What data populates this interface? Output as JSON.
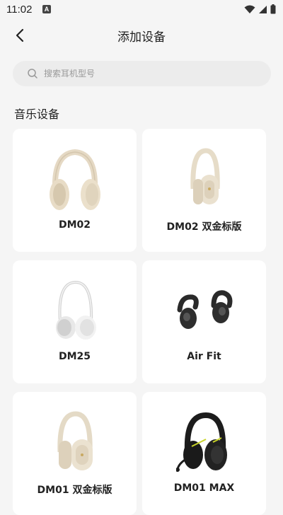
{
  "status": {
    "time": "11:02",
    "notification_badge": "A"
  },
  "header": {
    "title": "添加设备"
  },
  "search": {
    "placeholder": "搜索耳机型号"
  },
  "section": {
    "title": "音乐设备"
  },
  "devices": [
    {
      "label": "DM02",
      "icon": "headphones-cream-icon"
    },
    {
      "label": "DM02 双金标版",
      "icon": "headphones-cream-gold-icon"
    },
    {
      "label": "DM25",
      "icon": "headphones-white-onear-icon"
    },
    {
      "label": "Air Fit",
      "icon": "open-earbuds-icon"
    },
    {
      "label": "DM01 双金标版",
      "icon": "headphones-cream-gold-icon"
    },
    {
      "label": "DM01 MAX",
      "icon": "gaming-headset-black-icon"
    }
  ],
  "colors": {
    "background": "#f5f5f5",
    "card": "#ffffff",
    "search_bg": "#ececec",
    "text": "#222222",
    "placeholder": "#999999"
  }
}
